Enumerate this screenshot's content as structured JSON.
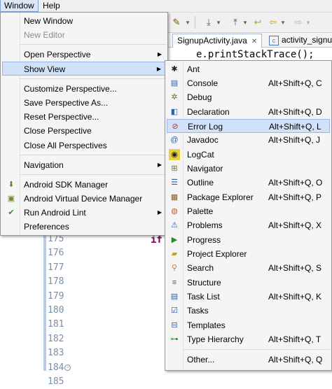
{
  "menubar": {
    "window": "Window",
    "help": "Help"
  },
  "editor": {
    "tab_active": "SignupActivity.java",
    "tab_close": "✕",
    "tab_other": "activity_signup",
    "tab_other_icon": "c",
    "code_line": "e.printStackTrace();",
    "code_if": "if",
    "line_numbers": [
      "175",
      "176",
      "177",
      "178",
      "179",
      "180",
      "181",
      "182",
      "183",
      "184",
      "185"
    ]
  },
  "window_menu": {
    "new_window": "New Window",
    "new_editor": "New Editor",
    "open_perspective": "Open Perspective",
    "show_view": "Show View",
    "customize_perspective": "Customize Perspective...",
    "save_perspective_as": "Save Perspective As...",
    "reset_perspective": "Reset Perspective...",
    "close_perspective": "Close Perspective",
    "close_all_perspectives": "Close All Perspectives",
    "navigation": "Navigation",
    "android_sdk_manager": "Android SDK Manager",
    "android_avd_manager": "Android Virtual Device Manager",
    "run_android_lint": "Run Android Lint",
    "preferences": "Preferences"
  },
  "show_view_menu": {
    "ant": {
      "label": "Ant",
      "shortcut": ""
    },
    "console": {
      "label": "Console",
      "shortcut": "Alt+Shift+Q, C"
    },
    "debug": {
      "label": "Debug",
      "shortcut": ""
    },
    "declaration": {
      "label": "Declaration",
      "shortcut": "Alt+Shift+Q, D"
    },
    "error_log": {
      "label": "Error Log",
      "shortcut": "Alt+Shift+Q, L"
    },
    "javadoc": {
      "label": "Javadoc",
      "shortcut": "Alt+Shift+Q, J"
    },
    "logcat": {
      "label": "LogCat",
      "shortcut": ""
    },
    "navigator": {
      "label": "Navigator",
      "shortcut": ""
    },
    "outline": {
      "label": "Outline",
      "shortcut": "Alt+Shift+Q, O"
    },
    "package_explorer": {
      "label": "Package Explorer",
      "shortcut": "Alt+Shift+Q, P"
    },
    "palette": {
      "label": "Palette",
      "shortcut": ""
    },
    "problems": {
      "label": "Problems",
      "shortcut": "Alt+Shift+Q, X"
    },
    "progress": {
      "label": "Progress",
      "shortcut": ""
    },
    "project_explorer": {
      "label": "Project Explorer",
      "shortcut": ""
    },
    "search": {
      "label": "Search",
      "shortcut": "Alt+Shift+Q, S"
    },
    "structure": {
      "label": "Structure",
      "shortcut": ""
    },
    "task_list": {
      "label": "Task List",
      "shortcut": "Alt+Shift+Q, K"
    },
    "tasks": {
      "label": "Tasks",
      "shortcut": ""
    },
    "templates": {
      "label": "Templates",
      "shortcut": ""
    },
    "type_hierarchy": {
      "label": "Type Hierarchy",
      "shortcut": "Alt+Shift+Q, T"
    },
    "other": {
      "label": "Other...",
      "shortcut": "Alt+Shift+Q, Q"
    }
  },
  "colors": {
    "highlight": "#d1e2f8",
    "highlight_border": "#97b8e4",
    "menu_bg": "#f5f5f5"
  }
}
